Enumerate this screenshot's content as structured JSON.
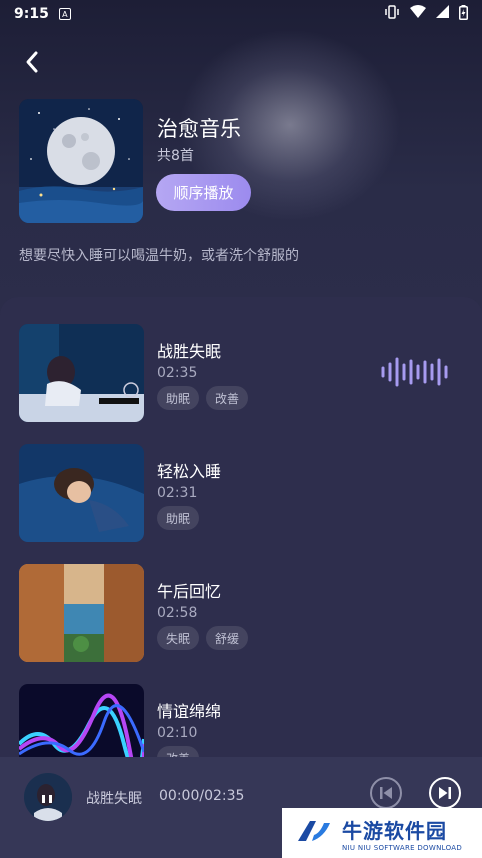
{
  "status_bar": {
    "time": "9:15",
    "icons": [
      "notification-a-icon",
      "vibrate-icon",
      "wifi-icon",
      "signal-icon",
      "battery-icon"
    ]
  },
  "header": {
    "back_icon": "chevron-left-icon"
  },
  "album": {
    "title": "治愈音乐",
    "count": "共8首",
    "play_label": "顺序播放",
    "description": "想要尽快入睡可以喝温牛奶，或者洗个舒服的"
  },
  "tracks": [
    {
      "name": "战胜失眠",
      "duration": "02:35",
      "tags": [
        "助眠",
        "改善"
      ],
      "playing": true
    },
    {
      "name": "轻松入睡",
      "duration": "02:31",
      "tags": [
        "助眠"
      ],
      "playing": false
    },
    {
      "name": "午后回忆",
      "duration": "02:58",
      "tags": [
        "失眠",
        "舒缓"
      ],
      "playing": false
    },
    {
      "name": "情谊绵绵",
      "duration": "02:10",
      "tags": [
        "改善"
      ],
      "playing": false
    }
  ],
  "player": {
    "title": "战胜失眠",
    "time": "00:00/02:35",
    "prev_icon": "skip-previous-icon",
    "next_icon": "skip-next-icon"
  },
  "watermark": {
    "cn": "牛游软件园",
    "en": "NIU NIU SOFTWARE DOWNLOAD"
  },
  "colors": {
    "background": "#2a2a46",
    "list_panel": "#2e2e4d",
    "player_bar": "#363757",
    "accent": "#9c8bee",
    "tag_bg": "#44445f",
    "wave": "#a79bf0"
  }
}
